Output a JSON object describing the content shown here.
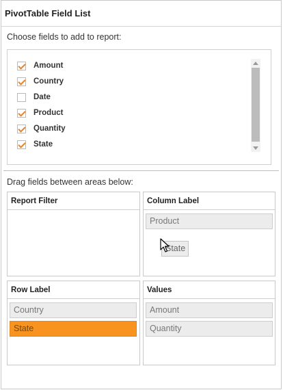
{
  "title": "PivotTable Field List",
  "choose_label": "Choose fields to add to report:",
  "fields": [
    {
      "label": "Amount",
      "checked": true
    },
    {
      "label": "Country",
      "checked": true
    },
    {
      "label": "Date",
      "checked": false
    },
    {
      "label": "Product",
      "checked": true
    },
    {
      "label": "Quantity",
      "checked": true
    },
    {
      "label": "State",
      "checked": true
    }
  ],
  "drag_label": "Drag fields between areas below:",
  "areas": {
    "report_filter": {
      "title": "Report Filter",
      "items": []
    },
    "column_label": {
      "title": "Column Label",
      "items": [
        "Product"
      ]
    },
    "row_label": {
      "title": "Row Label",
      "items": [
        "Country",
        "State"
      ],
      "selected": "State"
    },
    "values": {
      "title": "Values",
      "items": [
        "Amount",
        "Quantity"
      ]
    }
  },
  "drag_ghost": "State",
  "colors": {
    "accent": "#f7931e",
    "check": "#e8822a"
  }
}
